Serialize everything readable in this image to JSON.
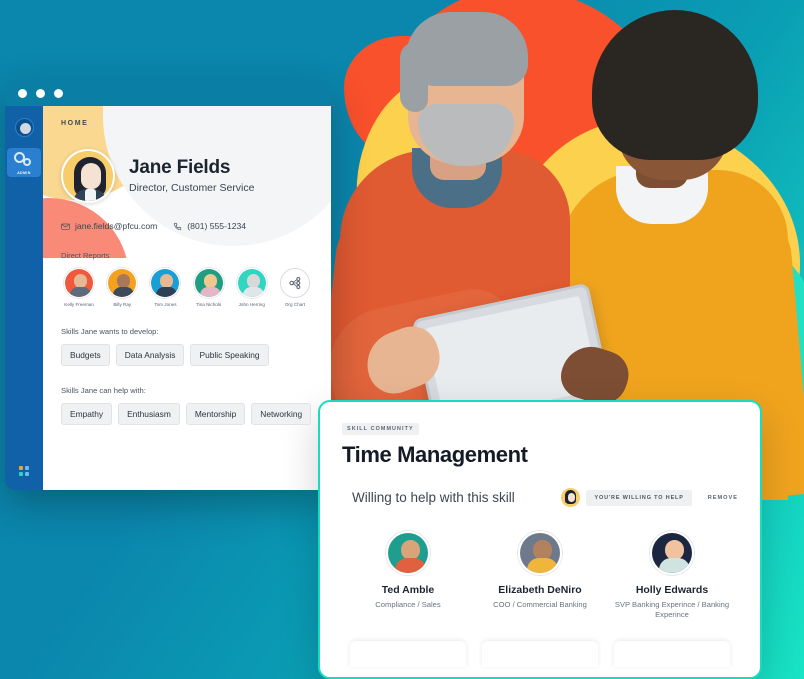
{
  "window": {
    "titlebar_dots": 3,
    "rail": {
      "items": [
        {
          "name": "user-avatar",
          "label": ""
        },
        {
          "name": "admin-gears",
          "label": "ADMIN"
        }
      ],
      "apps_label": "apps-grid"
    },
    "page": {
      "breadcrumb": "HOME",
      "profile": {
        "name": "Jane Fields",
        "title": "Director, Customer Service",
        "email": "jane.fields@pfcu.com",
        "phone": "(801) 555-1234"
      },
      "direct_reports_label": "Direct Reports",
      "direct_reports": [
        {
          "name": "Kelly Freeman",
          "bg": "#f05a3c",
          "head": "#e7b894",
          "body": "#5e6b7a"
        },
        {
          "name": "Billy Ray",
          "bg": "#f4a11f",
          "head": "#a9785a",
          "body": "#3f4a59"
        },
        {
          "name": "Tom Jones",
          "bg": "#1a9fd4",
          "head": "#e7b894",
          "body": "#2f3f55"
        },
        {
          "name": "Tina Nichols",
          "bg": "#1f9e82",
          "head": "#f0c88f",
          "body": "#e4b7c8"
        },
        {
          "name": "John Herring",
          "bg": "#2fd6c2",
          "head": "#d8d8d8",
          "body": "#dfe6ea"
        },
        {
          "name": "Org Chart",
          "bg": "#ffffff",
          "head": "#ffffff",
          "body": "#ffffff"
        }
      ],
      "skills_develop_label": "Skills Jane wants to develop:",
      "skills_develop": [
        "Budgets",
        "Data Analysis",
        "Public Speaking"
      ],
      "skills_help_label": "Skills Jane can help with:",
      "skills_help": [
        "Empathy",
        "Enthusiasm",
        "Mentorship",
        "Networking"
      ]
    }
  },
  "skill_card": {
    "tag": "SKILL COMMUNITY",
    "title": "Time Management",
    "subtitle": "Willing to help with this skill",
    "badge": "YOU'RE WILLING TO HELP",
    "remove_label": "REMOVE",
    "people": [
      {
        "name": "Ted Amble",
        "role": "Compliance / Sales",
        "bg": "#1f9e8f",
        "head": "#d9a478",
        "body": "#e0603f"
      },
      {
        "name": "Elizabeth DeNiro",
        "role": "COO / Commercial Banking",
        "bg": "#6e7a8c",
        "head": "#b2825e",
        "body": "#f0b63c"
      },
      {
        "name": "Holly Edwards",
        "role": "SVP Banking Experince / Banking Experince",
        "bg": "#1b2640",
        "head": "#f0c2a0",
        "body": "#cfe3e0"
      }
    ],
    "accent_color": "#17dcc0"
  },
  "theme": {
    "background_start": "#0b86ad",
    "background_end": "#19e4c5",
    "rail_color": "#1161a8",
    "titlebar_color": "#0a7ea4"
  }
}
